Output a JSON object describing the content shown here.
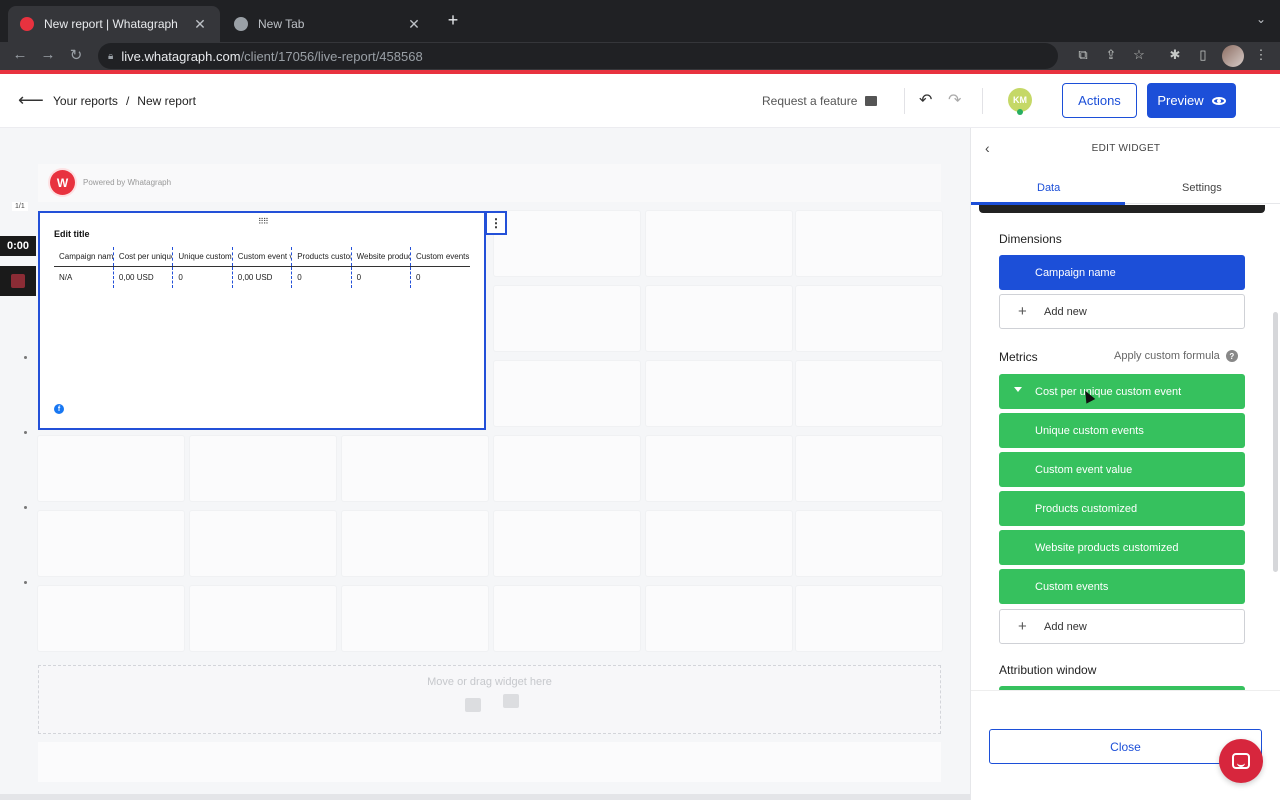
{
  "browser": {
    "tabs": [
      {
        "title": "New report | Whatagraph",
        "favicon_color": "#e8323f"
      },
      {
        "title": "New Tab"
      }
    ],
    "url_host": "live.whatagraph.com",
    "url_path": "/client/17056/live-report/458568"
  },
  "header": {
    "breadcrumb": [
      "Your reports",
      "New report"
    ],
    "breadcrumb_sep": "/",
    "request_feature": "Request a feature",
    "avatar_initials": "KM",
    "actions_label": "Actions",
    "preview_label": "Preview"
  },
  "canvas": {
    "powered_by": "Powered by Whatagraph",
    "page_indicator": "1/1",
    "timer": "0:00",
    "dropzone_text": "Move or drag widget here"
  },
  "widget": {
    "title": "Edit title",
    "columns": [
      "Campaign name",
      "Cost per unique custom event",
      "Unique custom events",
      "Custom event value",
      "Products customized",
      "Website products customized",
      "Custom events"
    ],
    "rows": [
      [
        "N/A",
        "0,00 USD",
        "0",
        "0,00 USD",
        "0",
        "0",
        "0"
      ]
    ]
  },
  "panel": {
    "title": "EDIT WIDGET",
    "tabs": [
      "Data",
      "Settings"
    ],
    "dimensions_label": "Dimensions",
    "dimensions": [
      "Campaign name"
    ],
    "add_new": "Add new",
    "metrics_label": "Metrics",
    "custom_formula": "Apply custom formula",
    "metrics": [
      "Cost per unique custom event",
      "Unique custom events",
      "Custom event value",
      "Products customized",
      "Website products customized",
      "Custom events"
    ],
    "attribution_label": "Attribution window",
    "close_label": "Close"
  },
  "colors": {
    "brand_red": "#e8323f",
    "primary_blue": "#1c4fd8",
    "metric_green": "#36c15e"
  }
}
